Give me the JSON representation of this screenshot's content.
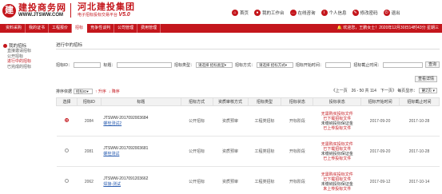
{
  "header": {
    "logo_cn": "建投商务网",
    "logo_url": "WWW.JTSWW.COM",
    "logo_cn2": "河北建投集团",
    "logo_sub": "电子招标投标交易平台",
    "logo_version": "V5.0",
    "nav": [
      {
        "label": "首页",
        "icon": "home-icon"
      },
      {
        "label": "我的工作台",
        "icon": "user-icon"
      },
      {
        "label": "在线咨询",
        "icon": "chat-icon"
      },
      {
        "label": "个人信息",
        "icon": "profile-icon"
      },
      {
        "label": "修改密码",
        "icon": "edit-icon"
      },
      {
        "label": "退出",
        "icon": "logout-icon"
      }
    ]
  },
  "menubar": {
    "items": [
      "资料采购",
      "我的证书",
      "工程报价",
      "招标",
      "竞争性谈判",
      "公司管理",
      "费用管理"
    ],
    "active_index": 3,
    "welcome": "欢迎您，王鹏女士！2020年12月30日14时43分 星期三"
  },
  "sidebar": {
    "title": "我的招标",
    "items": [
      "直接邀请招标",
      "公开招标",
      "进行中的招标",
      "已完成的招标"
    ],
    "active_index": 2
  },
  "main": {
    "title": "进行中的招标",
    "filter": {
      "code_label": "招标ID：",
      "name_label": "标题：",
      "type_label": "招标类型：",
      "type_value": "请选择 招标类型",
      "method_label": "招标方式：",
      "method_value": "请选择 招标方式",
      "start_label": "招标开始时间：",
      "end_label": "招标截止时间：",
      "search_button": "查询"
    },
    "view_detail_button": "查看详情",
    "sort": {
      "label": "排序依据",
      "field": "招标ID",
      "desc": "↑ 升序",
      "asc": "↓ 降序"
    },
    "pager": {
      "text": "《上一页　26 - 50 共 114　下一页》 每页显示：",
      "page_size": "第2页"
    },
    "columns": [
      "选择",
      "招标ID",
      "标题",
      "招标方式",
      "资质审核方式",
      "招标类型",
      "招标状态",
      "投标状态",
      "招标开始时间",
      "招标截止时间"
    ],
    "rows": [
      {
        "selected": true,
        "id": "2084",
        "code": "JTSWW-2017092003684",
        "title": "螺栓测试2",
        "method": "公开招标",
        "review": "资质预审",
        "type": "工程类招标",
        "status": "开标阶段",
        "bid_status": [
          "无需购买投标文件",
          "已下载招标文件",
          "未缴纳投标保证金",
          "已上传投标文件"
        ],
        "start": "2017-09-20",
        "end": "2017-10-28"
      },
      {
        "selected": false,
        "id": "2081",
        "code": "JTSWW-2017092003681",
        "title": "螺栓测试",
        "method": "公开招标",
        "review": "资质预审",
        "type": "工程类招标",
        "status": "开标阶段",
        "bid_status": [
          "无需购买投标文件",
          "已下载招标文件",
          "未缴纳投标保证金",
          "已上传投标文件"
        ],
        "start": "2017-09-20",
        "end": "2017-10-28"
      },
      {
        "selected": false,
        "id": "2062",
        "code": "JTSWW-2017091203662",
        "title": "焊接-测试",
        "method": "公开招标",
        "review": "资质预审",
        "type": "工程类招标",
        "status": "开标阶段",
        "bid_status": [
          "无需购买投标文件",
          "已下载招标文件",
          "未缴纳投标保证金",
          "未上传投标文件"
        ],
        "start": "2017-09-12",
        "end": "2017-10-14"
      }
    ]
  },
  "colors": {
    "brand": "#c4161c",
    "link": "#2a5db0"
  }
}
